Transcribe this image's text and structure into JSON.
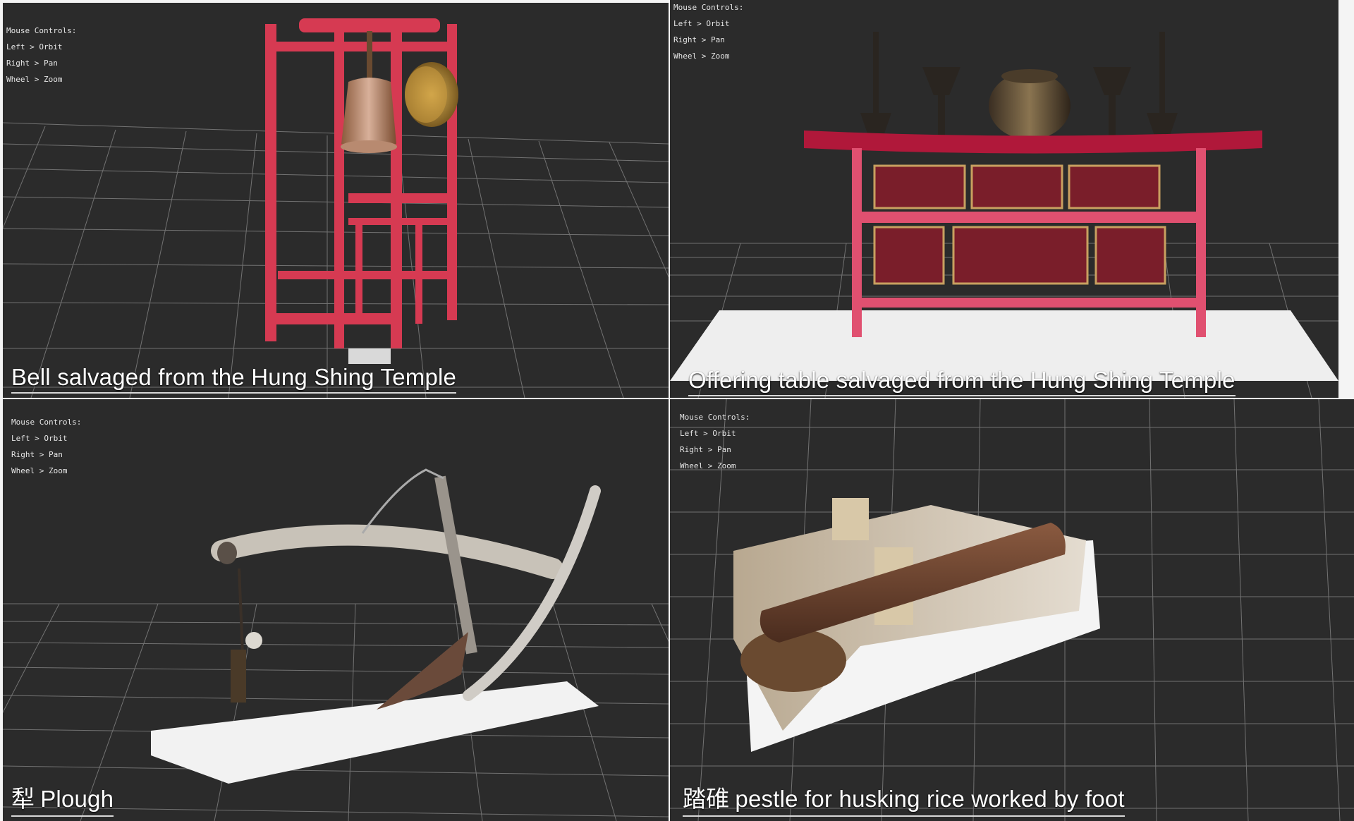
{
  "controls": {
    "heading": "Mouse Controls:",
    "left": "Left > Orbit",
    "right": "Right > Pan",
    "wheel": "Wheel > Zoom"
  },
  "viewers": [
    {
      "caption": "Bell salvaged from the Hung Shing Temple",
      "caption_cjk": "",
      "object_icon": "bell-tower-model"
    },
    {
      "caption": "Offering table salvaged from the Hung Shing Temple",
      "caption_cjk": "",
      "object_icon": "offering-table-model"
    },
    {
      "caption": "Plough",
      "caption_cjk": "犁",
      "object_icon": "plough-model"
    },
    {
      "caption": "pestle for husking rice worked by foot",
      "caption_cjk": "踏碓",
      "object_icon": "foot-pestle-model"
    }
  ],
  "colors": {
    "background": "#2b2b2b",
    "grid": "#8a8a8a",
    "frame_red": "#d63a52",
    "caption_text": "#ffffff"
  }
}
